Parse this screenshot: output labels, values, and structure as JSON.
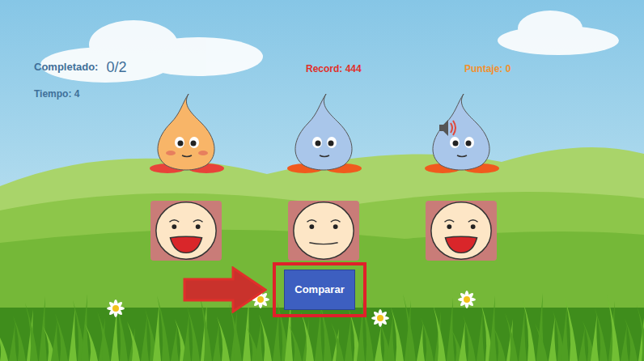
{
  "hud": {
    "completed_label": "Completado:",
    "completed": "0/2",
    "time": "Tiempo: 4",
    "record": "Record: 444",
    "score": "Puntaje: 0"
  },
  "characters": [
    {
      "color": "#f8b568",
      "foot_color": "#e8423a",
      "blush": true,
      "sound": false
    },
    {
      "color": "#a9c6ea",
      "foot_color": "#f05a1e",
      "blush": false,
      "sound": false
    },
    {
      "color": "#a9c6ea",
      "foot_color": "#f05a1e",
      "blush": false,
      "sound": true
    }
  ],
  "faces": [
    {
      "kind": "happy"
    },
    {
      "kind": "neutral"
    },
    {
      "kind": "happy"
    }
  ],
  "button": {
    "label": "Comparar",
    "highlighted": true
  }
}
